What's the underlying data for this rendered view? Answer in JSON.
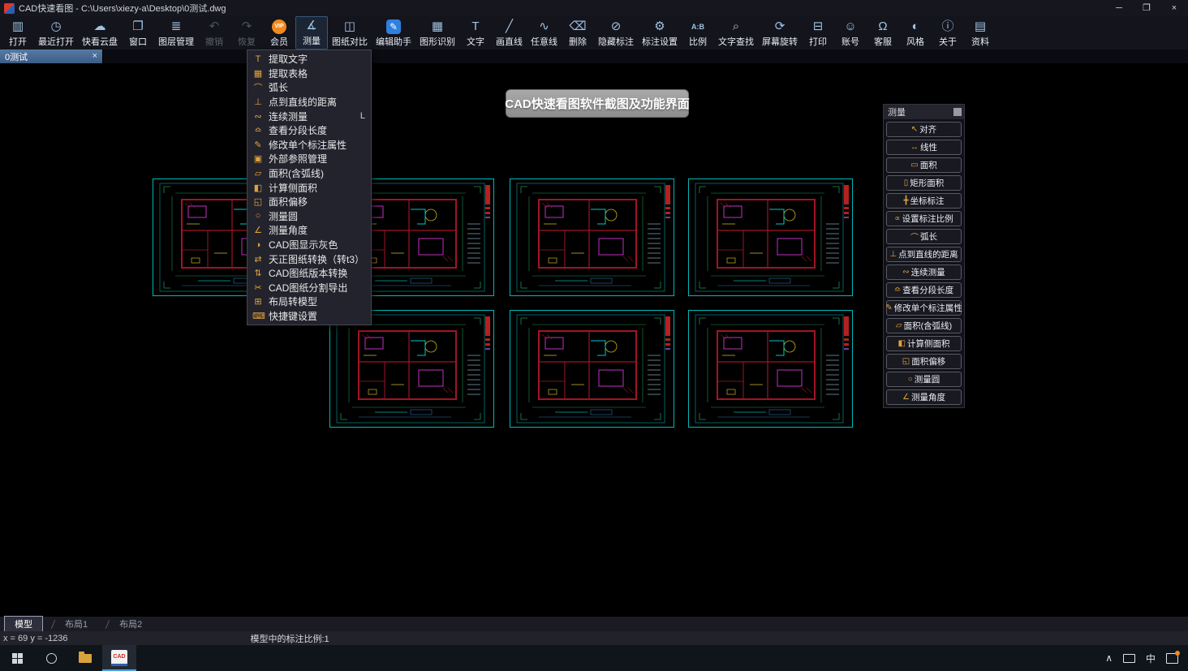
{
  "window": {
    "title": "CAD快速看图 - C:\\Users\\xiezy-a\\Desktop\\0测试.dwg",
    "minimize": "─",
    "restore": "❐",
    "close": "×"
  },
  "toolbar": {
    "items": [
      {
        "name": "open",
        "label": "打开",
        "glyph": "▥"
      },
      {
        "name": "recent-open",
        "label": "最近打开",
        "glyph": "◷"
      },
      {
        "name": "cloud-disk",
        "label": "快看云盘",
        "glyph": "☁"
      },
      {
        "name": "window",
        "label": "窗口",
        "glyph": "❐"
      },
      {
        "name": "layer-manager",
        "label": "图层管理",
        "glyph": "≣"
      },
      {
        "name": "undo",
        "label": "撤销",
        "glyph": "↶",
        "disabled": true
      },
      {
        "name": "redo",
        "label": "恢复",
        "glyph": "↷",
        "disabled": true
      },
      {
        "name": "vip-member",
        "label": "会员",
        "glyph": "VIP",
        "kind": "vip"
      },
      {
        "name": "measure",
        "label": "测量",
        "glyph": "∡",
        "active": true
      },
      {
        "name": "drawing-compare",
        "label": "图纸对比",
        "glyph": "◫"
      },
      {
        "name": "edit-assistant",
        "label": "编辑助手",
        "glyph": "✎",
        "kind": "edit"
      },
      {
        "name": "shape-recognition",
        "label": "图形识别",
        "glyph": "▦"
      },
      {
        "name": "text",
        "label": "文字",
        "glyph": "T"
      },
      {
        "name": "draw-line",
        "label": "画直线",
        "glyph": "╱"
      },
      {
        "name": "free-line",
        "label": "任意线",
        "glyph": "∿"
      },
      {
        "name": "delete",
        "label": "删除",
        "glyph": "⌫"
      },
      {
        "name": "hide-annotation",
        "label": "隐藏标注",
        "glyph": "⊘"
      },
      {
        "name": "annotation-settings",
        "label": "标注设置",
        "glyph": "⚙"
      },
      {
        "name": "scale-ratio",
        "label": "比例",
        "glyph": "A:B",
        "kind": "small"
      },
      {
        "name": "text-search",
        "label": "文字查找",
        "glyph": "⌕"
      },
      {
        "name": "screen-rotate",
        "label": "屏幕旋转",
        "glyph": "⟳"
      },
      {
        "name": "print",
        "label": "打印",
        "glyph": "⊟"
      },
      {
        "name": "account",
        "label": "账号",
        "glyph": "☺"
      },
      {
        "name": "customer-service",
        "label": "客服",
        "glyph": "Ω"
      },
      {
        "name": "style",
        "label": "风格",
        "glyph": "◐"
      },
      {
        "name": "about",
        "label": "关于",
        "glyph": "ⓘ"
      },
      {
        "name": "materials",
        "label": "资料",
        "glyph": "▤"
      }
    ]
  },
  "doc_tab": {
    "label": "0测试",
    "close": "×"
  },
  "measure_menu": {
    "items": [
      {
        "name": "extract-text",
        "label": "提取文字",
        "glyph": "T",
        "shortcut": ""
      },
      {
        "name": "extract-table",
        "label": "提取表格",
        "glyph": "▦",
        "shortcut": ""
      },
      {
        "name": "arc-length",
        "label": "弧长",
        "glyph": "⌒",
        "shortcut": ""
      },
      {
        "name": "point-line-distance",
        "label": "点到直线的距离",
        "glyph": "⊥",
        "shortcut": ""
      },
      {
        "name": "continuous-measure",
        "label": "连续测量",
        "glyph": "∾",
        "shortcut": "L"
      },
      {
        "name": "segment-length",
        "label": "查看分段长度",
        "glyph": "≏",
        "shortcut": ""
      },
      {
        "name": "modify-annotation",
        "label": "修改单个标注属性",
        "glyph": "✎",
        "shortcut": ""
      },
      {
        "name": "xref-manager",
        "label": "外部参照管理",
        "glyph": "▣",
        "shortcut": ""
      },
      {
        "name": "area-with-arc",
        "label": "面积(含弧线)",
        "glyph": "▱",
        "shortcut": ""
      },
      {
        "name": "side-area",
        "label": "计算侧面积",
        "glyph": "◧",
        "shortcut": ""
      },
      {
        "name": "area-offset",
        "label": "面积偏移",
        "glyph": "◱",
        "shortcut": ""
      },
      {
        "name": "measure-circle",
        "label": "测量圆",
        "glyph": "○",
        "shortcut": ""
      },
      {
        "name": "measure-angle",
        "label": "测量角度",
        "glyph": "∠",
        "shortcut": ""
      },
      {
        "name": "cad-gray-display",
        "label": "CAD图显示灰色",
        "glyph": "◑",
        "shortcut": ""
      },
      {
        "name": "tianzheng-convert",
        "label": "天正图纸转换（转t3）",
        "glyph": "⇄",
        "shortcut": ""
      },
      {
        "name": "version-convert",
        "label": "CAD图纸版本转换",
        "glyph": "⇅",
        "shortcut": ""
      },
      {
        "name": "split-export",
        "label": "CAD图纸分割导出",
        "glyph": "✂",
        "shortcut": ""
      },
      {
        "name": "layout-to-model",
        "label": "布局转模型",
        "glyph": "⊞",
        "shortcut": ""
      },
      {
        "name": "shortcut-settings",
        "label": "快捷键设置",
        "glyph": "⌨",
        "shortcut": ""
      }
    ]
  },
  "banner": {
    "text": "CAD快速看图软件截图及功能界面"
  },
  "measure_panel": {
    "title": "测量",
    "items": [
      {
        "name": "align",
        "label": "对齐",
        "glyph": "↖"
      },
      {
        "name": "linear",
        "label": "线性",
        "glyph": "↔"
      },
      {
        "name": "area",
        "label": "面积",
        "glyph": "▭"
      },
      {
        "name": "rect-area",
        "label": "矩形面积",
        "glyph": "▯"
      },
      {
        "name": "coordinate-annotation",
        "label": "坐标标注",
        "glyph": "╋"
      },
      {
        "name": "annotation-scale",
        "label": "设置标注比例",
        "glyph": "∝"
      },
      {
        "name": "arc-length",
        "label": "弧长",
        "glyph": "⌒"
      },
      {
        "name": "point-line-distance",
        "label": "点到直线的距离",
        "glyph": "⊥"
      },
      {
        "name": "continuous-measure",
        "label": "连续测量",
        "glyph": "∾"
      },
      {
        "name": "segment-length",
        "label": "查看分段长度",
        "glyph": "≏"
      },
      {
        "name": "modify-annotation",
        "label": "修改单个标注属性",
        "glyph": "✎"
      },
      {
        "name": "area-with-arc",
        "label": "面积(含弧线)",
        "glyph": "▱"
      },
      {
        "name": "side-area",
        "label": "计算侧面积",
        "glyph": "◧"
      },
      {
        "name": "area-offset",
        "label": "面积偏移",
        "glyph": "◱"
      },
      {
        "name": "measure-circle",
        "label": "测量圆",
        "glyph": "○"
      },
      {
        "name": "measure-angle",
        "label": "测量角度",
        "glyph": "∠"
      }
    ]
  },
  "sheet_tabs": [
    {
      "name": "model",
      "label": "模型"
    },
    {
      "name": "layout1",
      "label": "布局1"
    },
    {
      "name": "layout2",
      "label": "布局2"
    }
  ],
  "status_bar": {
    "coordinates": "x = 69  y = -1236",
    "scale_text": "模型中的标注比例:1"
  },
  "taskbar": {
    "cad_tile_text": "CAD",
    "tray_up": "∧",
    "ime_label": "中"
  },
  "colors": {
    "canvas_outline": "#00b8b8",
    "wall_red": "#a01525",
    "highlight_magenta": "#c030c0",
    "dim_green": "#1f8f4f",
    "detail_yellow": "#c8b020",
    "title_block_red": "#b52020",
    "menu_icon_gold": "#e0a33c",
    "vip_orange": "#f08a1e",
    "assistant_blue": "#2f7fe0"
  }
}
